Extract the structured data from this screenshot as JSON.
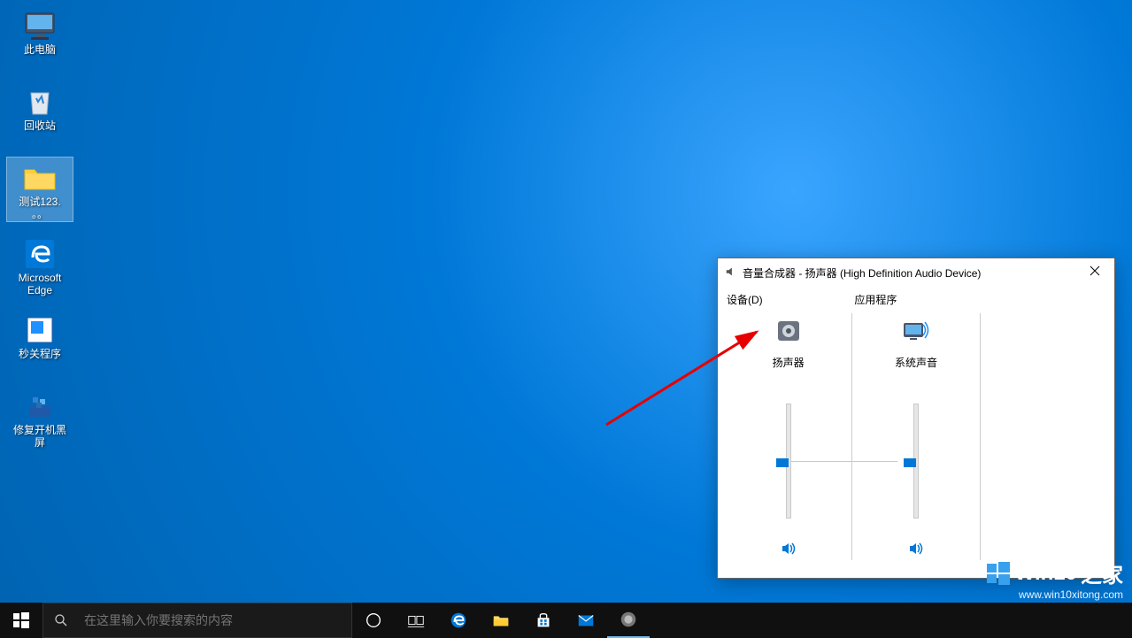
{
  "desktop": {
    "icons": [
      {
        "label": "此电脑",
        "name": "this-pc"
      },
      {
        "label": "回收站",
        "name": "recycle-bin"
      },
      {
        "label": "测试123.\n。。",
        "name": "folder-test123",
        "selected": true
      },
      {
        "label": "Microsoft\nEdge",
        "name": "edge"
      },
      {
        "label": "秒关程序",
        "name": "quick-close"
      },
      {
        "label": "修复开机黑\n屏",
        "name": "fix-boot"
      }
    ]
  },
  "taskbar": {
    "search_placeholder": "在这里输入你要搜索的内容"
  },
  "mixer": {
    "title": "音量合成器 - 扬声器 (High Definition Audio Device)",
    "device_header": "设备(D)",
    "app_header": "应用程序",
    "device_label": "扬声器",
    "app_label": "系统声音",
    "device_level": 50,
    "app_level": 50
  },
  "watermark": {
    "main": "Win10",
    "suffix": "之家",
    "url": "www.win10xitong.com"
  }
}
